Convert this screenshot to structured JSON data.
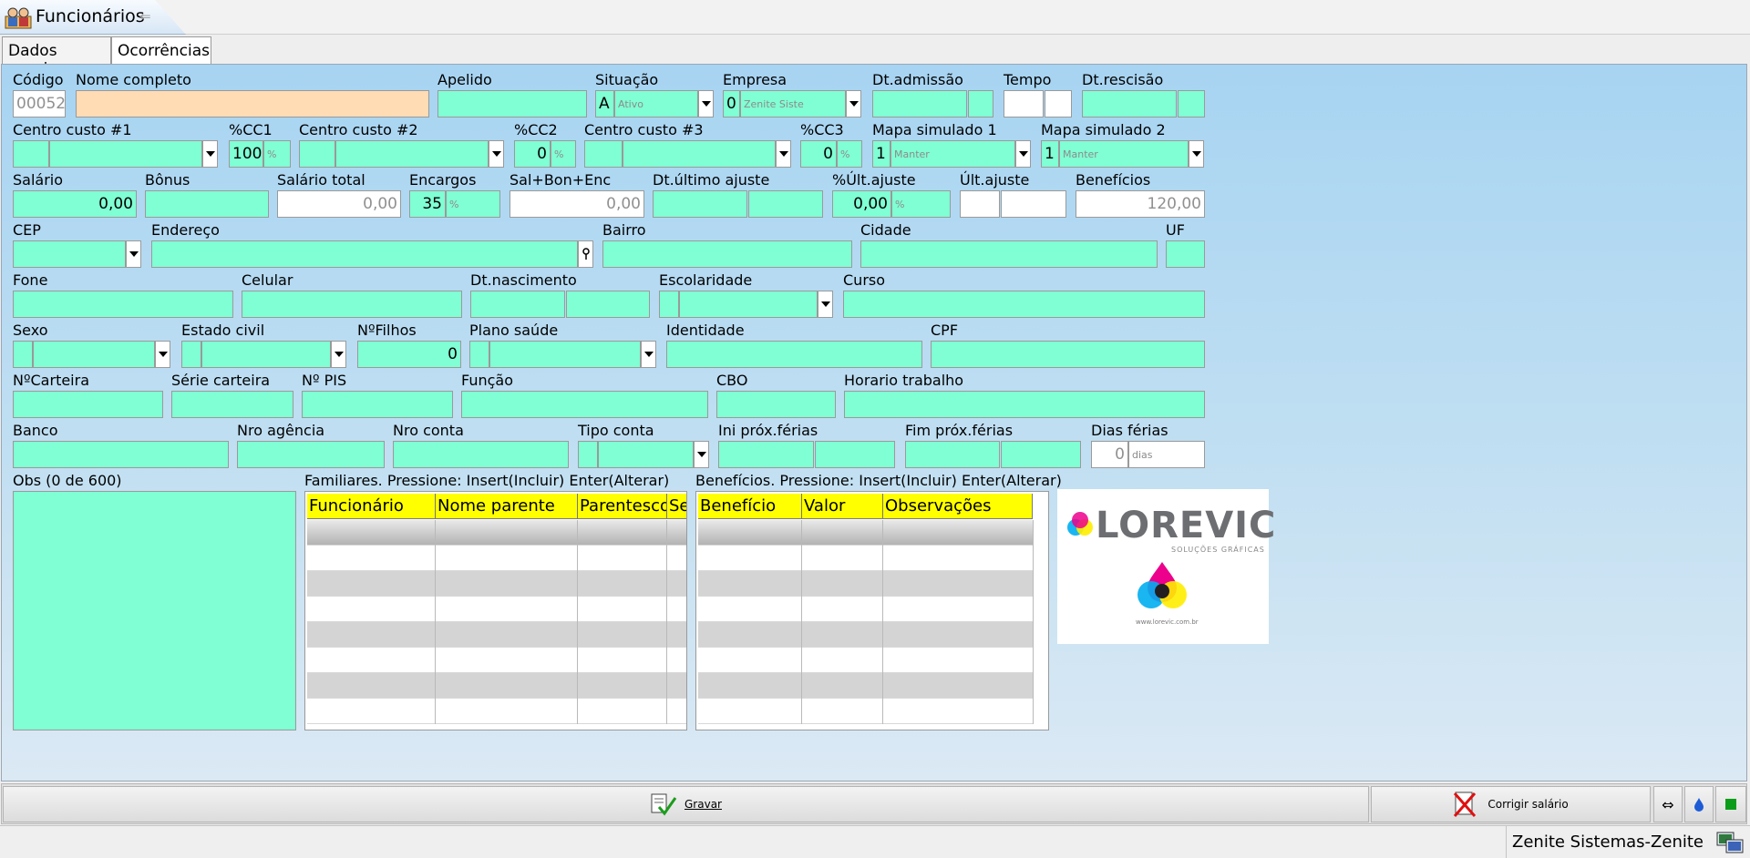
{
  "window": {
    "title": "Funcionários",
    "back_glyph": "⇐"
  },
  "tabs": [
    {
      "label": "Dados gerais"
    },
    {
      "label": "Ocorrências"
    }
  ],
  "form": {
    "codigo": {
      "label": "Código",
      "value": "00052"
    },
    "nome_completo": {
      "label": "Nome completo",
      "value": ""
    },
    "apelido": {
      "label": "Apelido",
      "value": ""
    },
    "situacao": {
      "label": "Situação",
      "code": "A",
      "text": "Ativo"
    },
    "empresa": {
      "label": "Empresa",
      "code": "0",
      "text": "Zenite Siste"
    },
    "dt_admissao": {
      "label": "Dt.admissão"
    },
    "tempo": {
      "label": "Tempo"
    },
    "dt_rescisao": {
      "label": "Dt.rescisão"
    },
    "centro_custo_1": {
      "label": "Centro custo #1"
    },
    "pct_cc1": {
      "label": "%CC1",
      "value": "100",
      "unit": "%"
    },
    "centro_custo_2": {
      "label": "Centro custo #2"
    },
    "pct_cc2": {
      "label": "%CC2",
      "value": "0",
      "unit": "%"
    },
    "centro_custo_3": {
      "label": "Centro custo #3"
    },
    "pct_cc3": {
      "label": "%CC3",
      "value": "0",
      "unit": "%"
    },
    "mapa_simulado_1": {
      "label": "Mapa simulado 1",
      "code": "1",
      "text": "Manter"
    },
    "mapa_simulado_2": {
      "label": "Mapa simulado 2",
      "code": "1",
      "text": "Manter"
    },
    "salario": {
      "label": "Salário",
      "value": "0,00"
    },
    "bonus": {
      "label": "Bônus"
    },
    "salario_total": {
      "label": "Salário total",
      "value": "0,00"
    },
    "encargos": {
      "label": "Encargos",
      "value": "35",
      "unit": "%"
    },
    "sal_bon_enc": {
      "label": "Sal+Bon+Enc",
      "value": "0,00"
    },
    "dt_ultimo_ajuste": {
      "label": "Dt.último ajuste"
    },
    "pct_ult_ajuste": {
      "label": "%Últ.ajuste",
      "value": "0,00",
      "unit": "%"
    },
    "ult_ajuste": {
      "label": "Últ.ajuste"
    },
    "beneficios": {
      "label": "Benefícios",
      "value": "120,00"
    },
    "cep": {
      "label": "CEP"
    },
    "endereco": {
      "label": "Endereço",
      "icon": "pin-icon"
    },
    "bairro": {
      "label": "Bairro"
    },
    "cidade": {
      "label": "Cidade"
    },
    "uf": {
      "label": "UF"
    },
    "fone": {
      "label": "Fone"
    },
    "celular": {
      "label": "Celular"
    },
    "dt_nascimento": {
      "label": "Dt.nascimento"
    },
    "escolaridade": {
      "label": "Escolaridade"
    },
    "curso": {
      "label": "Curso"
    },
    "sexo": {
      "label": "Sexo"
    },
    "estado_civil": {
      "label": "Estado civil"
    },
    "n_filhos": {
      "label": "NºFilhos",
      "value": "0"
    },
    "plano_saude": {
      "label": "Plano saúde"
    },
    "identidade": {
      "label": "Identidade"
    },
    "cpf": {
      "label": "CPF"
    },
    "n_carteira": {
      "label": "NºCarteira"
    },
    "serie_carteira": {
      "label": "Série carteira"
    },
    "n_pis": {
      "label": "Nº PIS"
    },
    "funcao": {
      "label": "Função"
    },
    "cbo": {
      "label": "CBO"
    },
    "horario_trabalho": {
      "label": "Horario trabalho"
    },
    "banco": {
      "label": "Banco"
    },
    "nro_agencia": {
      "label": "Nro agência"
    },
    "nro_conta": {
      "label": "Nro conta"
    },
    "tipo_conta": {
      "label": "Tipo conta"
    },
    "ini_prox_ferias": {
      "label": "Ini próx.férias"
    },
    "fim_prox_ferias": {
      "label": "Fim próx.férias"
    },
    "dias_ferias": {
      "label": "Dias férias",
      "value": "0",
      "unit": "dias"
    },
    "obs": {
      "label": "Obs (0 de 600)"
    }
  },
  "familiares": {
    "caption": "Familiares.  Pressione: Insert(Incluir) Enter(Alterar)",
    "columns": [
      "Funcionário",
      "Nome parente",
      "Parentesco",
      "Se"
    ]
  },
  "beneficios_grid": {
    "caption": "Benefícios.  Pressione: Insert(Incluir) Enter(Alterar)",
    "columns": [
      "Benefício",
      "Valor",
      "Observações"
    ]
  },
  "logo": {
    "text": "LOREVIC",
    "subtitle": "SOLUÇÕES GRÁFICAS",
    "url": "www.lorevic.com.br"
  },
  "buttons": {
    "gravar": "Gravar",
    "corrigir_salario": "Corrigir salário"
  },
  "status": {
    "text": "Zenite Sistemas-Zenite"
  },
  "colors": {
    "field": "#80ffd4",
    "highlight_field": "#ffdcb4",
    "grid_header": "#ffff00"
  }
}
